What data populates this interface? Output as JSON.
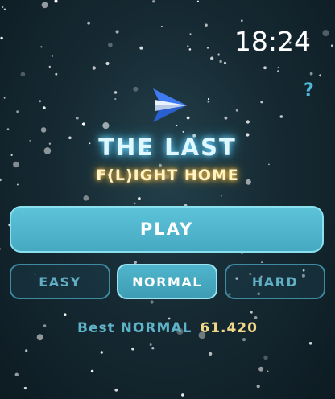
{
  "clock": {
    "time": "18:24"
  },
  "help": {
    "label": "?"
  },
  "title": {
    "line1": "THE LAST",
    "line2": "F(L)IGHT HOME"
  },
  "buttons": {
    "play": "PLAY",
    "easy": "EASY",
    "normal": "NORMAL",
    "hard": "HARD"
  },
  "selected_difficulty": "NORMAL",
  "best": {
    "label": "Best NORMAL",
    "value": "61.420"
  },
  "icons": {
    "ship": "paper-plane-ship-icon",
    "help": "question-mark-icon"
  },
  "colors": {
    "accent": "#5cc3d9",
    "title_glow": "#6fd7ff",
    "subtitle_glow": "#ffc64a",
    "best_value": "#f1d889",
    "background": "#162a33"
  }
}
